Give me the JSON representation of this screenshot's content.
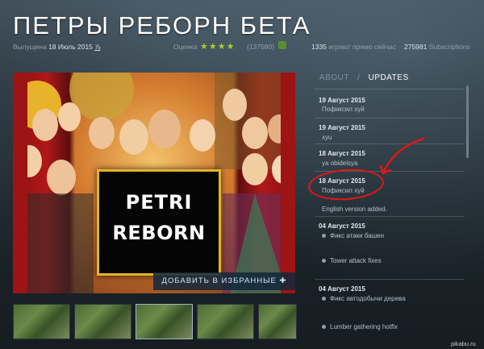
{
  "game": {
    "title": "ПЕТРЫ РЕБОРН БЕТА",
    "released_label": "Выпущена",
    "released_date": "18 Июль 2015",
    "rating_label": "Оценка",
    "stars": "★★★★",
    "rating_count": "(137580)",
    "playing_count": "1335",
    "playing_label": "играют прямо сейчас",
    "subscriptions_count": "275981",
    "subscriptions_label": "Subscriptions"
  },
  "art": {
    "logo_line1": "PETRI",
    "logo_line2": "REBORN",
    "favorite_button": "ДОБАВИТЬ В ИЗБРАННЫЕ"
  },
  "tabs": {
    "about": "ABOUT",
    "separator": "/",
    "updates": "UPDATES"
  },
  "updates": [
    {
      "date": "19 Август 2015",
      "text": "Пофиксил хуй",
      "bullet": false
    },
    {
      "date": "19 Август 2015",
      "text": "xyu",
      "bullet": false
    },
    {
      "date": "18 Август 2015",
      "text": "ya obidelsya",
      "bullet": false
    },
    {
      "date": "18 Август 2015",
      "text": "Пофиксил хуй",
      "bullet": false
    },
    {
      "date": "",
      "text": "English version added.",
      "bullet": false
    },
    {
      "date": "04 Август 2015",
      "text": "Фикс атаки башен",
      "bullet": true
    },
    {
      "date": "",
      "text": "Tower attack fixes",
      "bullet": true
    },
    {
      "date": "04 Август 2015",
      "text": "Фикс автодобычи дерева",
      "bullet": true
    },
    {
      "date": "",
      "text": "Lumber gathering hotfix",
      "bullet": true
    }
  ],
  "watermark": "pikabu.ru",
  "colors": {
    "accent_green": "#a7cc33",
    "annotation_red": "#e01818",
    "logo_border": "#e4b32b"
  }
}
